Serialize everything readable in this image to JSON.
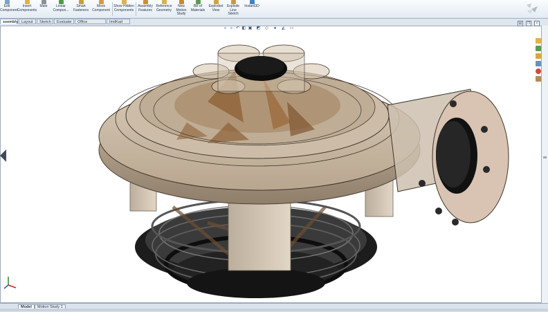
{
  "ribbon": {
    "buttons": [
      {
        "label": "Edit Component",
        "icon": "edit-component-icon",
        "color": "#7fa1c8"
      },
      {
        "label": "Insert Components",
        "icon": "insert-components-icon",
        "color": "#e2b23c"
      },
      {
        "label": "Mate",
        "icon": "mate-icon",
        "color": "#8a8f98"
      },
      {
        "label": "Linear Compon...",
        "icon": "linear-pattern-icon",
        "color": "#4f9a4a"
      },
      {
        "label": "Smart Fasteners",
        "icon": "smart-fasteners-icon",
        "color": "#c9a03a"
      },
      {
        "label": "Move Component",
        "icon": "move-component-icon",
        "color": "#d79b3a"
      },
      {
        "label": "Show Hidden Components",
        "icon": "show-hidden-icon",
        "color": "#e0b04a"
      },
      {
        "label": "Assembly Features",
        "icon": "assembly-features-icon",
        "color": "#cf8d2e"
      },
      {
        "label": "Reference Geometry",
        "icon": "reference-geometry-icon",
        "color": "#d9b24c"
      },
      {
        "label": "New Motion Study",
        "icon": "motion-study-icon",
        "color": "#c28a33"
      },
      {
        "label": "Bill of Materials",
        "icon": "bom-icon",
        "color": "#5c9a52"
      },
      {
        "label": "Exploded View",
        "icon": "exploded-view-icon",
        "color": "#d4a23a"
      },
      {
        "label": "Explode Line Sketch",
        "icon": "explode-line-icon",
        "color": "#c99b3a"
      },
      {
        "label": "Instant3D",
        "icon": "instant3d-icon",
        "color": "#3c83c4"
      }
    ]
  },
  "command_tabs": [
    "ssembly",
    "Layout",
    "Sketch",
    "Evaluate",
    "Office Products",
    "ImdKad 10"
  ],
  "active_tab": "ssembly",
  "bottom_tabs": [
    "Model",
    "Motion Study 1"
  ],
  "active_bottom_tab": "Model",
  "colors": {
    "ribbon_bg": "#e3ebf3",
    "viewport_bg": "#ffffff",
    "part_tan": "#c8b7a0",
    "part_dark": "#2b2b2b"
  }
}
